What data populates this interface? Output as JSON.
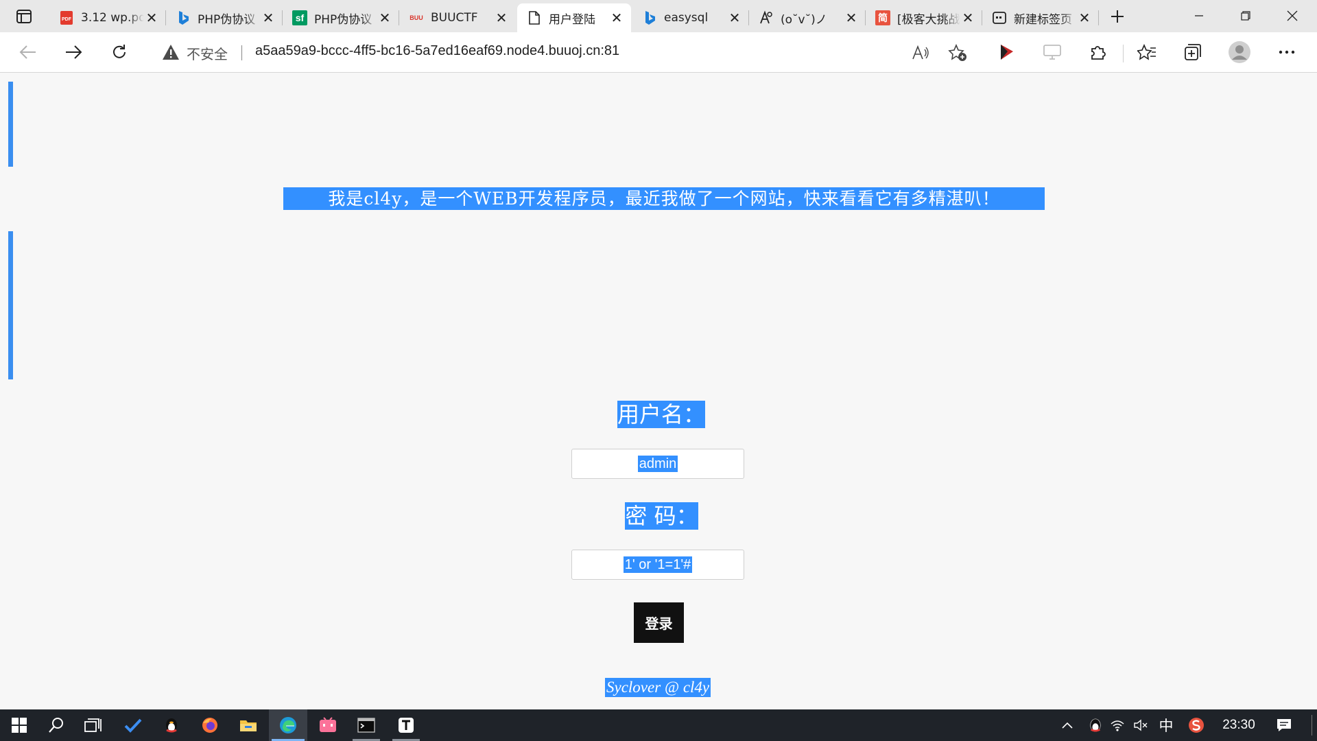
{
  "browser": {
    "tabs": [
      {
        "title": "3.12 wp.pdf",
        "favicon": "pdf-icon",
        "favicon_text": "PDF",
        "active": false
      },
      {
        "title": "PHP伪协议",
        "favicon": "bing-icon",
        "active": false
      },
      {
        "title": "PHP伪协议",
        "favicon": "sf-icon",
        "favicon_text": "sf",
        "active": false
      },
      {
        "title": "BUUCTF",
        "favicon": "buuctf-icon",
        "favicon_text": "BUU",
        "active": false
      },
      {
        "title": "用户登陆",
        "favicon": "page-icon",
        "active": true
      },
      {
        "title": "easysql",
        "favicon": "bing-icon",
        "active": false
      },
      {
        "title": "(o˘v˘)ノ",
        "favicon": "translate-icon",
        "active": false
      },
      {
        "title": "[极客大挑战",
        "favicon": "jian-icon",
        "favicon_text": "简",
        "active": false
      },
      {
        "title": "新建标签页",
        "favicon": "newtab-icon",
        "active": false
      }
    ],
    "address": {
      "security_label": "不安全",
      "url": "a5aa59a9-bccc-4ff5-bc16-5a7ed16eaf69.node4.buuoj.cn:81"
    }
  },
  "page": {
    "intro_text": "我是cl4y，是一个WEB开发程序员，最近我做了一个网站，快来看看它有多精湛叭！",
    "username_label": "用户名：",
    "username_value": "admin",
    "password_label": "密 码：",
    "password_value": "1' or '1=1'#",
    "login_label": "登录",
    "footer_text": "Syclover @ cl4y"
  },
  "taskbar": {
    "ime": "中",
    "clock": "23:30"
  },
  "colors": {
    "selection": "#3390ff",
    "accent_bar": "#3a8ef0",
    "login_button": "#111111",
    "taskbar": "#1f2329"
  }
}
